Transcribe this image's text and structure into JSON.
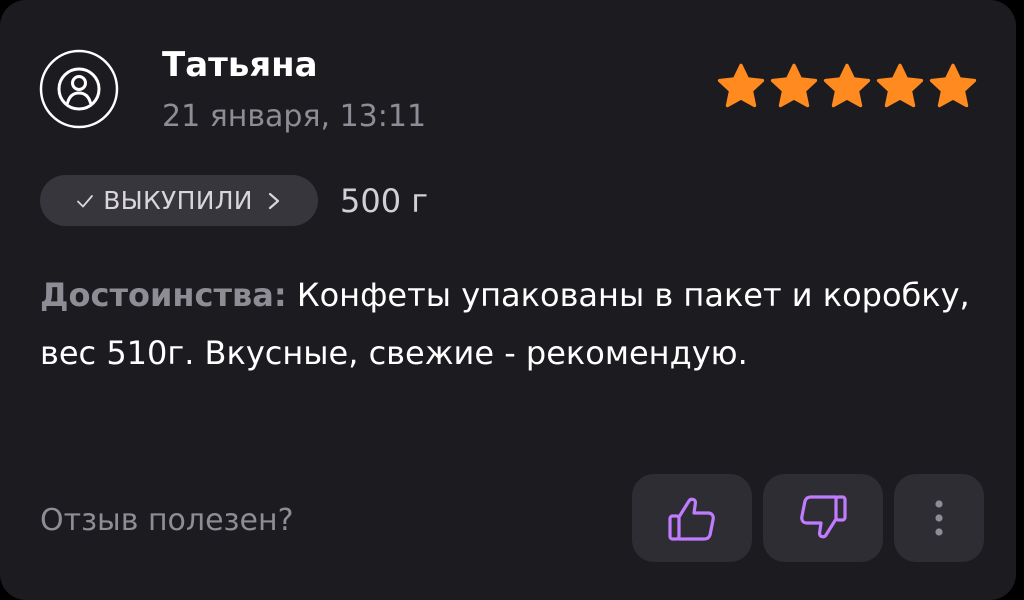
{
  "review": {
    "author": "Татьяна",
    "date": "21 января, 13:11",
    "rating": 5,
    "rating_max": 5,
    "badge_label": "ВЫКУПИЛИ",
    "variant": "500 г",
    "pros_label": "Достоинства:",
    "pros_text": "Конфеты упакованы в пакет и коробку, вес 510г. Вкусные, свежие - рекомендую."
  },
  "footer": {
    "helpful_prompt": "Отзыв полезен?"
  },
  "icons": {
    "avatar": "user-circle-icon",
    "star": "star-icon",
    "badge_check": "check-icon",
    "badge_chevron": "chevron-right-icon",
    "like": "thumbs-up-icon",
    "dislike": "thumbs-down-icon",
    "more": "more-vertical-icon"
  },
  "colors": {
    "card_background": "#1c1b20",
    "star": "#ff8a1f",
    "thumb_icon": "#c07cff",
    "muted_text": "#8e8c94",
    "button_background": "#2e2d33",
    "badge_background": "#38363d"
  }
}
